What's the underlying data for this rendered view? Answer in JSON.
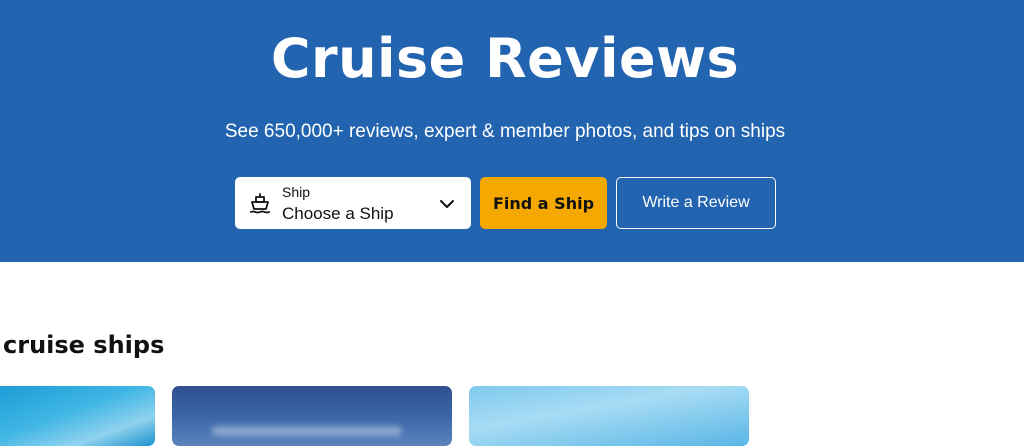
{
  "hero": {
    "title": "Cruise Reviews",
    "subtitle": "See 650,000+ reviews, expert & member photos, and tips on ships",
    "background_color": "#2264b0"
  },
  "search": {
    "field_label": "Ship",
    "placeholder": "Choose a Ship",
    "icon": "ship-icon",
    "find_button_label": "Find a Ship",
    "find_button_color": "#f5a800",
    "review_button_label": "Write a Review"
  },
  "section": {
    "heading": "cruise ships"
  }
}
